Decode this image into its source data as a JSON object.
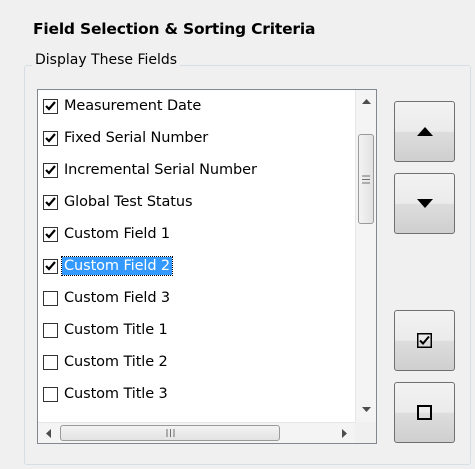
{
  "header": {
    "title": "Field Selection & Sorting Criteria"
  },
  "group": {
    "legend": "Display These Fields"
  },
  "fields": [
    {
      "label": "Measurement Date",
      "checked": true,
      "selected": false
    },
    {
      "label": "Fixed Serial Number",
      "checked": true,
      "selected": false
    },
    {
      "label": "Incremental Serial Number",
      "checked": true,
      "selected": false
    },
    {
      "label": "Global Test Status",
      "checked": true,
      "selected": false
    },
    {
      "label": "Custom Field 1",
      "checked": true,
      "selected": false
    },
    {
      "label": "Custom Field 2",
      "checked": true,
      "selected": true
    },
    {
      "label": "Custom Field 3",
      "checked": false,
      "selected": false
    },
    {
      "label": "Custom Title 1",
      "checked": false,
      "selected": false
    },
    {
      "label": "Custom Title 2",
      "checked": false,
      "selected": false
    },
    {
      "label": "Custom Title 3",
      "checked": false,
      "selected": false
    }
  ],
  "buttons": {
    "move_up_icon": "triangle-up-icon",
    "move_down_icon": "triangle-down-icon",
    "check_all_icon": "checked-box-icon",
    "uncheck_all_icon": "empty-box-icon"
  },
  "colors": {
    "selection": "#3399ff",
    "selection_text": "#ffffff",
    "group_border": "#d5dfe5",
    "background": "#f0f0f0"
  }
}
